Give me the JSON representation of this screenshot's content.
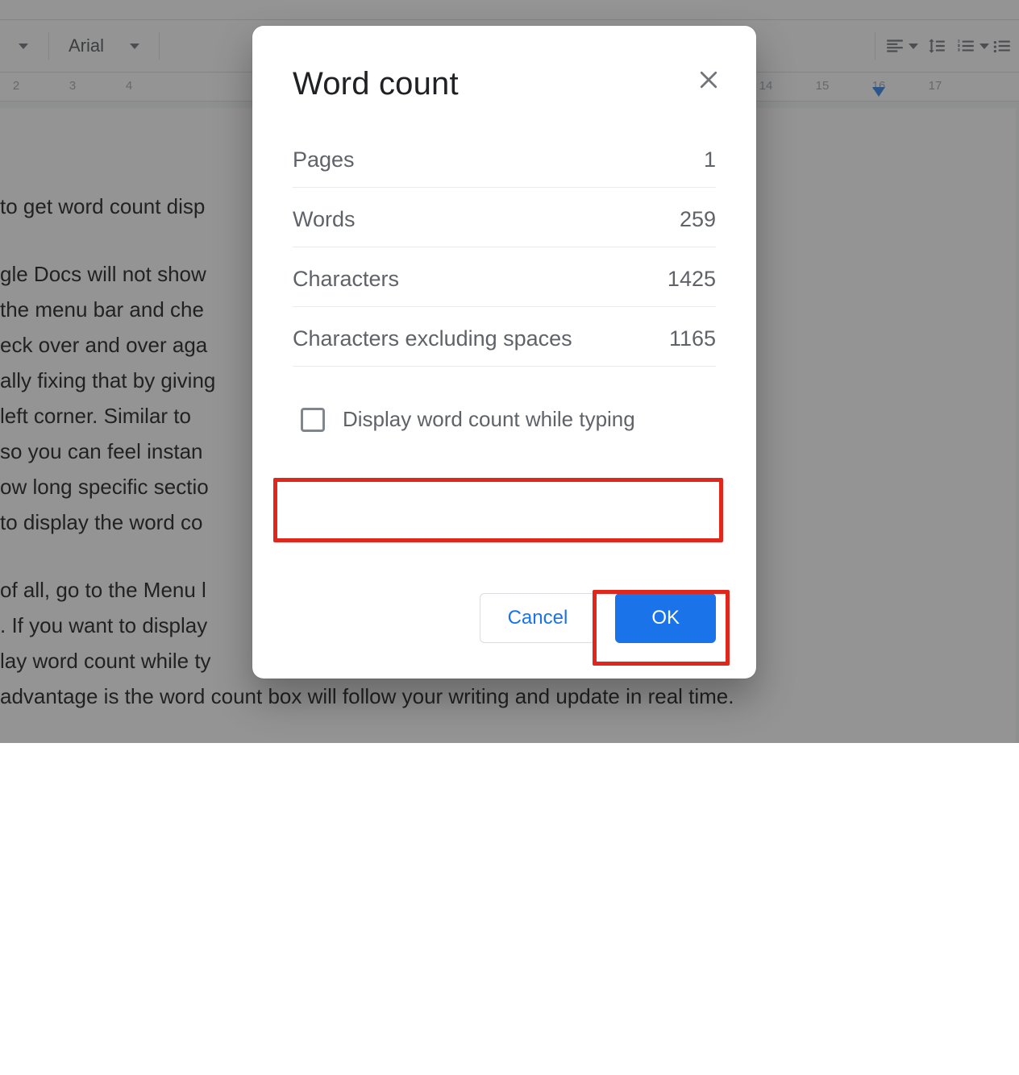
{
  "toolbar": {
    "font": "Arial"
  },
  "ruler": {
    "visible_numbers": [
      2,
      3,
      4,
      14,
      15,
      16,
      17
    ],
    "marker_at": 16
  },
  "document": {
    "line1": "to get word count disp",
    "para1": "gle Docs will not show                                                                u will need to\n the menu bar and che                                                             ting you have\neck over and over aga                                                            The tech giant\nally fixing that by giving                                                            d count in its |\n left corner. Similar to                                                                 bers in real\n so you can feel instan                                                              ther, you can\now long specific sectio\nto display the word co",
    "para2": "of all, go to the Menu l                                                               count of your\n. If you want to display                                                             o click\nlay word count while ty                                                             r on your left.\nadvantage is the word count box will follow your writing and update in real time."
  },
  "dialog": {
    "title": "Word count",
    "stats": [
      {
        "label": "Pages",
        "value": "1"
      },
      {
        "label": "Words",
        "value": "259"
      },
      {
        "label": "Characters",
        "value": "1425"
      },
      {
        "label": "Characters excluding spaces",
        "value": "1165"
      }
    ],
    "checkbox_label": "Display word count while typing",
    "cancel": "Cancel",
    "ok": "OK"
  }
}
